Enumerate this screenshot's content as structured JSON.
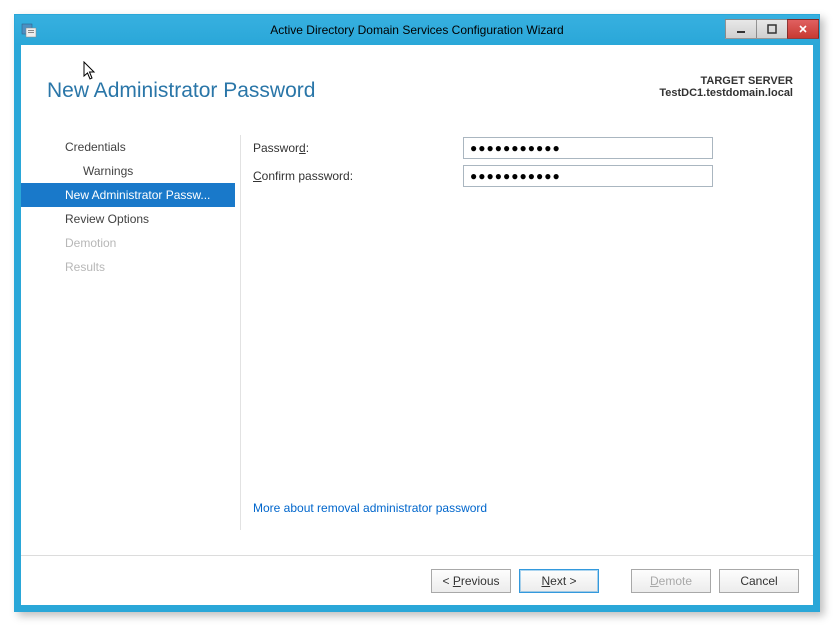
{
  "window": {
    "title": "Active Directory Domain Services Configuration Wizard"
  },
  "heading": "New Administrator Password",
  "target_server": {
    "label": "TARGET SERVER",
    "name": "TestDC1.testdomain.local"
  },
  "steps": {
    "credentials": "Credentials",
    "warnings": "Warnings",
    "new_admin_pw": "New Administrator Passw...",
    "review": "Review Options",
    "demotion": "Demotion",
    "results": "Results"
  },
  "form": {
    "password_label_pre": "Passwor",
    "password_label_ul": "d",
    "password_label_post": ":",
    "password_value": "●●●●●●●●●●●",
    "confirm_label_pre": "",
    "confirm_label_ul": "C",
    "confirm_label_post": "onfirm password:",
    "confirm_value": "●●●●●●●●●●●"
  },
  "help_link": "More about removal administrator password",
  "buttons": {
    "previous_pre": "< ",
    "previous_ul": "P",
    "previous_post": "revious",
    "next_pre": "",
    "next_ul": "N",
    "next_post": "ext >",
    "demote_pre": "",
    "demote_ul": "D",
    "demote_post": "emote",
    "cancel": "Cancel"
  }
}
